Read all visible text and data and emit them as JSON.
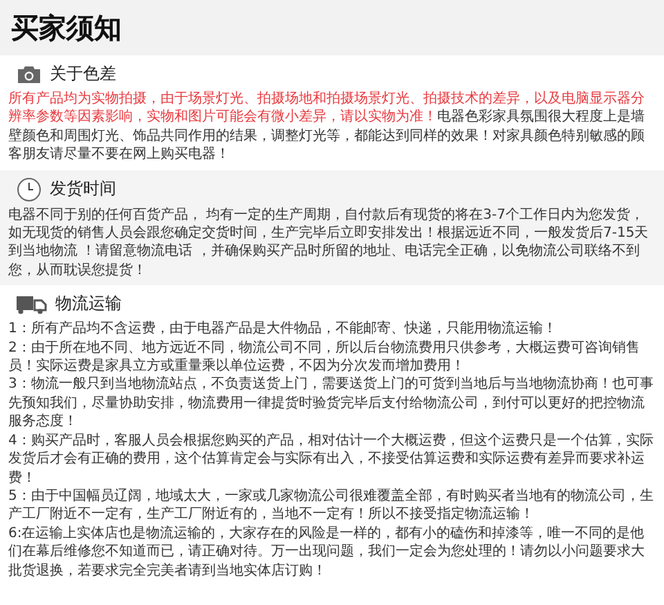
{
  "title": "买家须知",
  "sections": [
    {
      "kind": "camera",
      "heading": "关于色差",
      "paragraphs": [
        [
          {
            "kind": "warning",
            "text": "所有产品均为实物拍摄，由于场景灯光、拍摄场地和拍摄场景灯光、拍摄技术的差异，以及电脑显示器分辨率参数等因素影响，实物和图片可能会有微小差异，请以实物为准！"
          },
          {
            "kind": "normal",
            "text": "电器色彩家具氛围很大程度上是墙壁颜色和周围灯光、饰品共同作用的结果，调整灯光等，都能达到同样的效果！对家具颜色特别敏感的顾客朋友请尽量不要在网上购买电器！"
          }
        ]
      ]
    },
    {
      "kind": "clock",
      "heading": "发货时间",
      "paragraphs": [
        [
          {
            "kind": "normal",
            "text": "电器不同于别的任何百货产品， 均有一定的生产周期，自付款后有现货的将在3-7个工作日内为您发货，如无现货的销售人员会跟您确定交货时间，生产完毕后立即安排发出！根据远近不同，一般发货后7-15天到当地物流 ！请留意物流电话 ，并确保购买产品时所留的地址、电话完全正确，以免物流公司联络不到您，从而耽误您提货！"
          }
        ]
      ]
    },
    {
      "kind": "truck",
      "heading": "物流运输",
      "paragraphs": [
        [
          {
            "kind": "normal",
            "text": "1：所有产品均不含运费，由于电器产品是大件物品，不能邮寄、快递，只能用物流运输！"
          }
        ],
        [
          {
            "kind": "normal",
            "text": "2：由于所在地不同、地方远近不同，物流公司不同，所以后台物流费用只供参考，大概运费可咨询销售员！实际运费是家具立方或重量乘以单位运费，不因为分次发而增加费用！"
          }
        ],
        [
          {
            "kind": "normal",
            "text": "3：物流一般只到当地物流站点，不负责送货上门，需要送货上门的可货到当地后与当地物流协商！也可事先预知我们，尽量协助安排，物流费用一律提货时验货完毕后支付给物流公司，到付可以更好的把控物流服务态度！"
          }
        ],
        [
          {
            "kind": "normal",
            "text": "4：购买产品时，客服人员会根据您购买的产品，相对估计一个大概运费，但这个运费只是一个估算，实际发货后才会有正确的费用，这个估算肯定会与实际有出入，不接受估算运费和实际运费有差异而要求补运费！"
          }
        ],
        [
          {
            "kind": "normal",
            "text": "5：由于中国幅员辽阔，地域太大，一家或几家物流公司很难覆盖全部，有时购买者当地有的物流公司，生产工厂附近不一定有，生产工厂附近有的，当地不一定有！所以不接受指定物流运输！"
          }
        ],
        [
          {
            "kind": "normal",
            "text": "6:在运输上实体店也是物流运输的，大家存在的风险是一样的，都有小的磕伤和掉漆等，唯一不同的是他们在幕后维修您不知道而已，请正确对待。万一出现问题，我们一定会为您处理的！请勿以小问题要求大批货退换，若要求完全完美者请到当地实体店订购！"
          }
        ]
      ]
    }
  ]
}
